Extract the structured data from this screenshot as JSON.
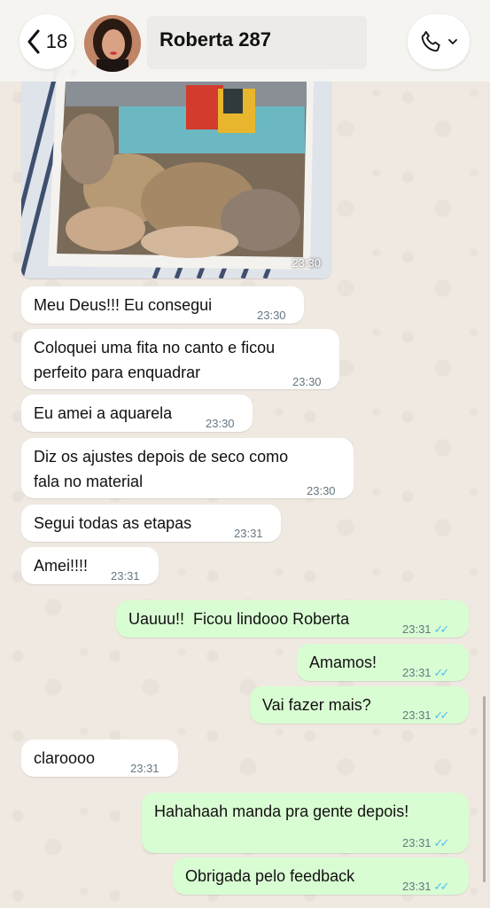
{
  "header": {
    "back_count": "18",
    "contact_name": "Roberta 287"
  },
  "photo_message": {
    "time": "23:30"
  },
  "messages": [
    {
      "direction": "incoming",
      "text": "Meu Deus!!! Eu consegui",
      "time": "23:30"
    },
    {
      "direction": "incoming",
      "text": "Coloquei uma fita no canto e ficou\nperfeito para enquadrar",
      "time": "23:30"
    },
    {
      "direction": "incoming",
      "text": "Eu amei a aquarela",
      "time": "23:30"
    },
    {
      "direction": "incoming",
      "text": "Diz os ajustes depois de seco como\nfala no material",
      "time": "23:30"
    },
    {
      "direction": "incoming",
      "text": "Segui todas as etapas",
      "time": "23:31"
    },
    {
      "direction": "incoming",
      "text": "Amei!!!!",
      "time": "23:31"
    },
    {
      "direction": "outgoing",
      "text": "Uauuu!!  Ficou lindooo Roberta",
      "time": "23:31",
      "status": "read"
    },
    {
      "direction": "outgoing",
      "text": "Amamos!",
      "time": "23:31",
      "status": "read"
    },
    {
      "direction": "outgoing",
      "text": "Vai fazer mais?",
      "time": "23:31",
      "status": "read"
    },
    {
      "direction": "incoming",
      "text": "claroooo",
      "time": "23:31"
    },
    {
      "direction": "outgoing",
      "text": "Hahahaah manda pra gente depois!",
      "time": "23:31",
      "status": "read"
    },
    {
      "direction": "outgoing",
      "text": "Obrigada pelo feedback",
      "time": "23:31",
      "status": "read"
    }
  ],
  "colors": {
    "incoming_bubble": "#ffffff",
    "outgoing_bubble": "#d9fdd3",
    "read_ticks": "#53bdeb",
    "wallpaper": "#efe9e1"
  }
}
